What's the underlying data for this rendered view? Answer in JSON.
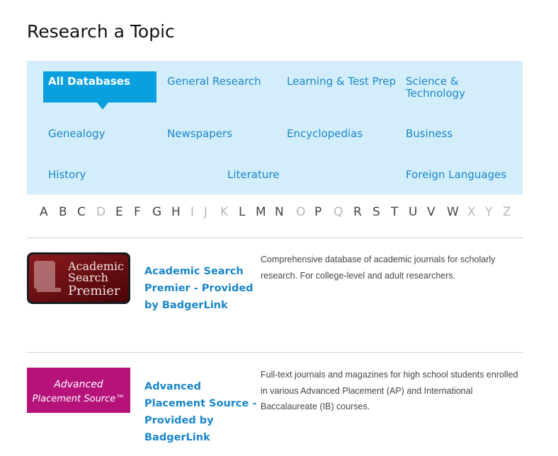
{
  "title": "Research a Topic",
  "topics": [
    "All Databases",
    "General Research",
    "Learning & Test Prep",
    "Science & Technology",
    "Genealogy",
    "Newspapers",
    "Encyclopedias",
    "Business",
    "History",
    "Literature",
    "Foreign Languages"
  ],
  "alphabet": {
    "letters": [
      "A",
      "B",
      "C",
      "D",
      "E",
      "F",
      "G",
      "H",
      "I",
      "J",
      "K",
      "L",
      "M",
      "N",
      "O",
      "P",
      "Q",
      "R",
      "S",
      "T",
      "U",
      "V",
      "W",
      "X",
      "Y",
      "Z"
    ],
    "disabled": [
      "D",
      "I",
      "J",
      "K",
      "O",
      "Q",
      "X",
      "Y",
      "Z"
    ]
  },
  "databases": [
    {
      "logo_text_1": "Academic",
      "logo_text_2": "Search",
      "logo_text_3": "Premier",
      "title": "Academic Search Premier - Provided by BadgerLink",
      "description": "Comprehensive database of academic journals for scholarly research. For college-level and adult researchers."
    },
    {
      "logo_text_1": "Advanced",
      "logo_text_2": "Placement Source™",
      "title": "Advanced Placement Source - Provided by BadgerLink",
      "description": "Full-text journals and magazines for high school students enrolled in various Advanced Placement (AP) and International Baccalaureate (IB) courses."
    }
  ],
  "colors": {
    "panel_bg": "#d3eefa",
    "active_tab": "#0aa0e0",
    "link": "#1a86c8",
    "logo1_bg": "#6b0f12",
    "logo2_bg": "#b5127a"
  }
}
